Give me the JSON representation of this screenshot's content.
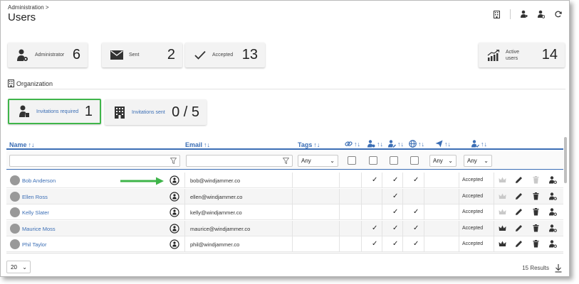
{
  "breadcrumb": "Administration",
  "breadcrumb_sep": ">",
  "page_title": "Users",
  "stats": {
    "administrator": {
      "label": "Administrator",
      "value": "6"
    },
    "sent": {
      "label": "Sent",
      "value": "2"
    },
    "accepted": {
      "label": "Accepted",
      "value": "13"
    },
    "active_users": {
      "label": "Active users",
      "value": "14"
    }
  },
  "organization": {
    "title": "Organization",
    "invitations_required": {
      "label": "Invitations required",
      "value": "1"
    },
    "invitations_sent": {
      "label": "Invitations sent",
      "value": "0 / 5"
    }
  },
  "columns": {
    "name": "Name",
    "email": "Email",
    "tags": "Tags",
    "sort": "↑↓"
  },
  "filters": {
    "tags_any": "Any",
    "send_any": "Any",
    "status_any": "Any"
  },
  "rows": [
    {
      "name": "Bob Anderson",
      "email": "bob@windjammer.co",
      "c1": "",
      "c2": "✓",
      "c3": "✓",
      "c4": "✓",
      "status": "Accepted"
    },
    {
      "name": "Ellen Ross",
      "email": "ellen@windjammer.co",
      "c1": "",
      "c2": "",
      "c3": "✓",
      "c4": "",
      "status": "Accepted"
    },
    {
      "name": "Kelly Slater",
      "email": "kelly@windjammer.co",
      "c1": "",
      "c2": "",
      "c3": "✓",
      "c4": "✓",
      "status": "Accepted"
    },
    {
      "name": "Maurice Moss",
      "email": "maurice@windjammer.co",
      "c1": "",
      "c2": "✓",
      "c3": "✓",
      "c4": "✓",
      "status": "Accepted"
    },
    {
      "name": "Phil Taylor",
      "email": "phil@windjammer.co",
      "c1": "",
      "c2": "✓",
      "c3": "✓",
      "c4": "✓",
      "status": "Accepted"
    }
  ],
  "pagination": {
    "page_size": "20",
    "results": "15 Results"
  },
  "colors": {
    "accent": "#3b6eb5",
    "highlight": "#3fb54a"
  }
}
